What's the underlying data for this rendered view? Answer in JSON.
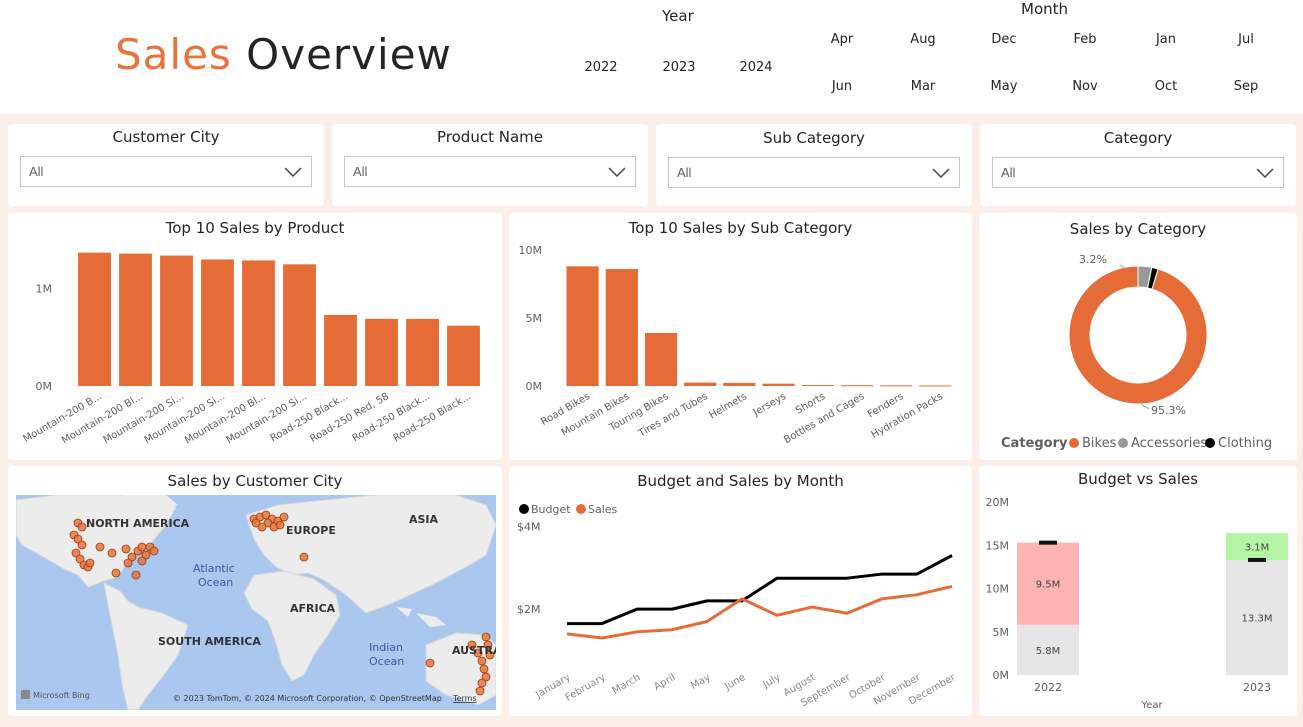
{
  "header": {
    "title_accent": "Sales",
    "title_rest": "Overview",
    "year_label": "Year",
    "years": [
      "2022",
      "2023",
      "2024"
    ],
    "month_label": "Month",
    "months_row1": [
      "Apr",
      "Aug",
      "Dec",
      "Feb",
      "Jan",
      "Jul"
    ],
    "months_row2": [
      "Jun",
      "Mar",
      "May",
      "Nov",
      "Oct",
      "Sep"
    ]
  },
  "filters": [
    {
      "title": "Customer City",
      "value": "All"
    },
    {
      "title": "Product Name",
      "value": "All"
    },
    {
      "title": "Sub Category",
      "value": "All"
    },
    {
      "title": "Category",
      "value": "All"
    }
  ],
  "colors": {
    "accent": "#e8743b",
    "bar": "#e66c37",
    "grey": "#999999",
    "black": "#000000",
    "budget_gap": "#ffb3b3",
    "surplus": "#b3f5a3",
    "base": "#e6e6e6"
  },
  "chart_data": [
    {
      "id": "top_products",
      "type": "bar",
      "title": "Top 10 Sales by Product",
      "categories": [
        "Mountain-200 B...",
        "Mountain-200 Bl...",
        "Mountain-200 Si...",
        "Mountain-200 Si...",
        "Mountain-200 Bl...",
        "Mountain-200 Si...",
        "Road-250 Black...",
        "Road-250 Red, 58",
        "Road-250 Black...",
        "Road-250 Black..."
      ],
      "values": [
        1.37,
        1.36,
        1.34,
        1.3,
        1.29,
        1.25,
        0.73,
        0.69,
        0.69,
        0.62
      ],
      "unit": "M",
      "yticks": [
        "0M",
        "1M"
      ],
      "ylim": [
        0,
        1.5
      ]
    },
    {
      "id": "top_subcategories",
      "type": "bar",
      "title": "Top 10 Sales by Sub Category",
      "categories": [
        "Road Bikes",
        "Mountain Bikes",
        "Touring Bikes",
        "Tires and Tubes",
        "Helmets",
        "Jerseys",
        "Shorts",
        "Bottles and Cages",
        "Fenders",
        "Hydration Packs"
      ],
      "values": [
        8.8,
        8.6,
        3.9,
        0.25,
        0.23,
        0.17,
        0.07,
        0.06,
        0.05,
        0.04
      ],
      "unit": "M",
      "yticks": [
        "0M",
        "5M",
        "10M"
      ],
      "ylim": [
        0,
        10
      ]
    },
    {
      "id": "sales_by_category",
      "type": "pie",
      "title": "Sales by Category",
      "legend_title": "Category",
      "labels": [
        "Bikes",
        "Accessories",
        "Clothing"
      ],
      "values": [
        95.3,
        3.2,
        1.5
      ],
      "data_labels": {
        "Bikes": "95.3%",
        "Accessories": "3.2%"
      },
      "legend_position": "bottom"
    },
    {
      "id": "budget_sales_month",
      "type": "line",
      "title": "Budget and Sales by Month",
      "x": [
        "January",
        "February",
        "March",
        "April",
        "May",
        "June",
        "July",
        "August",
        "September",
        "October",
        "November",
        "December"
      ],
      "series": [
        {
          "name": "Budget",
          "values": [
            1.65,
            1.65,
            2.0,
            2.0,
            2.2,
            2.2,
            2.75,
            2.75,
            2.75,
            2.85,
            2.85,
            3.3
          ]
        },
        {
          "name": "Sales",
          "values": [
            1.4,
            1.3,
            1.45,
            1.5,
            1.7,
            2.25,
            1.85,
            2.05,
            1.9,
            2.25,
            2.35,
            2.55
          ]
        }
      ],
      "yticks": [
        "$2M",
        "$4M"
      ],
      "ylim": [
        0.5,
        4.5
      ],
      "legend_position": "top-left"
    },
    {
      "id": "budget_vs_sales",
      "type": "bar",
      "title": "Budget vs Sales",
      "xlabel": "Year",
      "categories": [
        "2022",
        "2023"
      ],
      "base": [
        5.8,
        13.3
      ],
      "diff": [
        9.5,
        3.1
      ],
      "base_labels": [
        "5.8M",
        "13.3M"
      ],
      "diff_labels": [
        "9.5M",
        "3.1M"
      ],
      "budget": [
        15.3,
        13.3
      ],
      "yticks": [
        "0M",
        "5M",
        "10M",
        "15M",
        "20M"
      ],
      "ylim": [
        0,
        20
      ]
    }
  ],
  "map": {
    "title": "Sales by Customer City",
    "labels": [
      "NORTH AMERICA",
      "EUROPE",
      "ASIA",
      "Atlantic",
      "Ocean",
      "AFRICA",
      "SOUTH AMERICA",
      "Indian",
      "Ocean",
      "AUSTRAL"
    ],
    "attribution": "© 2023 TomTom, © 2024 Microsoft Corporation, © OpenStreetMap",
    "terms": "Terms",
    "logo": "Microsoft Bing"
  }
}
